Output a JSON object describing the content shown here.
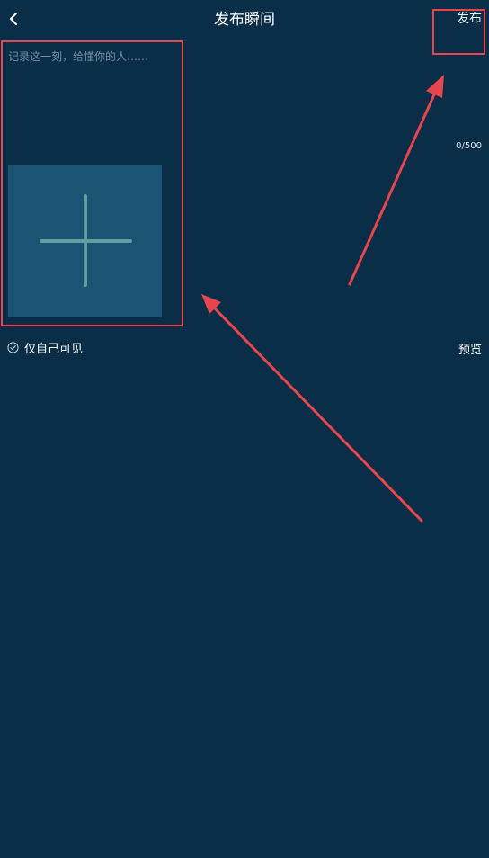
{
  "header": {
    "title": "发布瞬间",
    "publish_label": "发布"
  },
  "editor": {
    "placeholder": "记录这一刻，给懂你的人……",
    "value": "",
    "char_count": "0/500"
  },
  "options": {
    "private_label": "仅自己可见",
    "preview_label": "预览"
  },
  "colors": {
    "background": "#0a2e47",
    "tile": "#1b5472",
    "plus": "#5f9fa2",
    "highlight": "#e8464e"
  },
  "icons": {
    "back": "chevron-left-icon",
    "add": "plus-icon",
    "check": "check-circle-icon"
  }
}
